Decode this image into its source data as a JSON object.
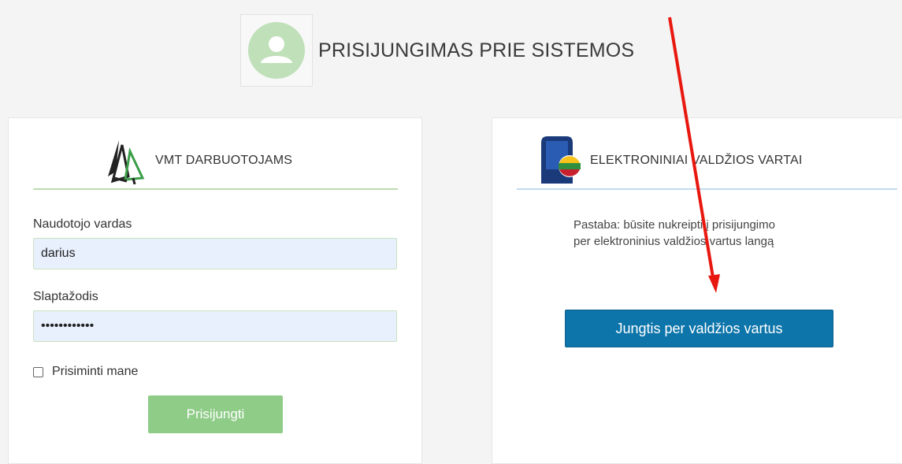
{
  "header": {
    "title": "PRISIJUNGIMAS PRIE SISTEMOS",
    "icon": "user-avatar-icon"
  },
  "login_panel": {
    "title": "VMT DARBUOTOJAMS",
    "logo_icon": "forest-trees-logo",
    "username_label": "Naudotojo vardas",
    "username_value": "darius",
    "password_label": "Slaptažodis",
    "password_value": "123456789012",
    "remember_label": "Prisiminti mane",
    "remember_checked": false,
    "submit_label": "Prisijungti"
  },
  "gov_panel": {
    "title": "ELEKTRONINIAI VALDŽIOS VARTAI",
    "logo_icon": "government-gateway-logo",
    "note_lines": [
      "Pastaba: būsite nukreipti į prisijungimo",
      "per elektroninius valdžios vartus langą"
    ],
    "button_label": "Jungtis per valdžios vartus"
  },
  "colors": {
    "green_accent": "#8fcc88",
    "blue_button": "#0d75aa",
    "annotation_arrow": "#e8170f"
  }
}
